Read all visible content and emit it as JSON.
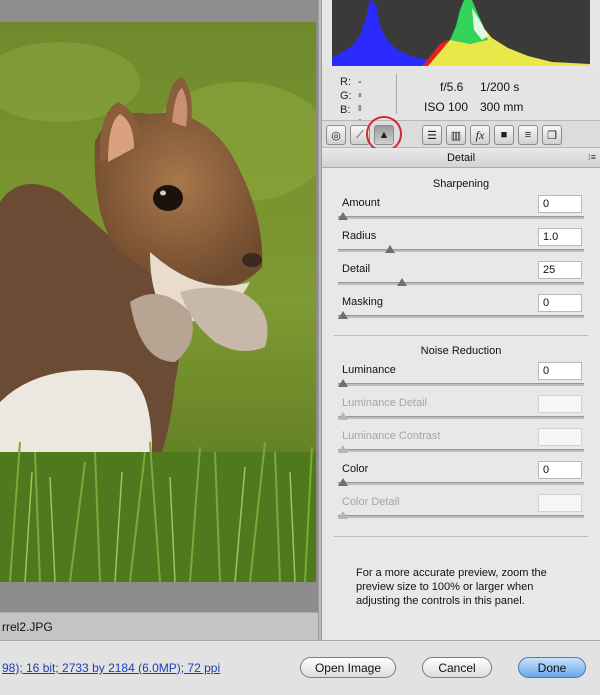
{
  "image": {
    "filename": "rrel2.JPG",
    "workflow_options": "98); 16 bit; 2733 by 2184 (6.0MP); 72 ppi"
  },
  "readout": {
    "r_label": "R:",
    "g_label": "G:",
    "b_label": "B:",
    "r_value": "---",
    "g_value": "---",
    "b_value": "---",
    "aperture": "f/5.6",
    "shutter": "1/200 s",
    "iso": "ISO 100",
    "focal_length": "300 mm"
  },
  "tabs": [
    {
      "icon": "aperture-icon"
    },
    {
      "icon": "tone-curve-icon"
    },
    {
      "icon": "detail-icon",
      "active": true
    },
    {
      "icon": "hsl-icon"
    },
    {
      "icon": "split-toning-icon"
    },
    {
      "icon": "lens-corrections-icon",
      "glyph": "fx"
    },
    {
      "icon": "camera-calibration-icon"
    },
    {
      "icon": "presets-icon"
    },
    {
      "icon": "snapshots-icon"
    }
  ],
  "panel": {
    "title": "Detail",
    "sharpening_heading": "Sharpening",
    "noise_heading": "Noise Reduction",
    "info": "For a more accurate preview, zoom the preview size to 100% or larger when adjusting the controls in this panel."
  },
  "sharpening": {
    "amount": {
      "label": "Amount",
      "value": "0",
      "fraction": 0.0
    },
    "radius": {
      "label": "Radius",
      "value": "1.0",
      "fraction": 0.2
    },
    "detail": {
      "label": "Detail",
      "value": "25",
      "fraction": 0.25
    },
    "masking": {
      "label": "Masking",
      "value": "0",
      "fraction": 0.0
    }
  },
  "noise": {
    "luminance": {
      "label": "Luminance",
      "value": "0",
      "fraction": 0.0
    },
    "luminance_detail": {
      "label": "Luminance Detail",
      "value": "",
      "fraction": 0.0,
      "disabled": true
    },
    "luminance_contrast": {
      "label": "Luminance Contrast",
      "value": "",
      "fraction": 0.0,
      "disabled": true
    },
    "color": {
      "label": "Color",
      "value": "0",
      "fraction": 0.0
    },
    "color_detail": {
      "label": "Color Detail",
      "value": "",
      "fraction": 0.0,
      "disabled": true
    }
  },
  "buttons": {
    "open_image": "Open Image",
    "cancel": "Cancel",
    "done": "Done"
  },
  "colors": {
    "accent_done": "#6aa7e8",
    "highlight_circle": "#d02a33",
    "link": "#1b3fb5"
  }
}
